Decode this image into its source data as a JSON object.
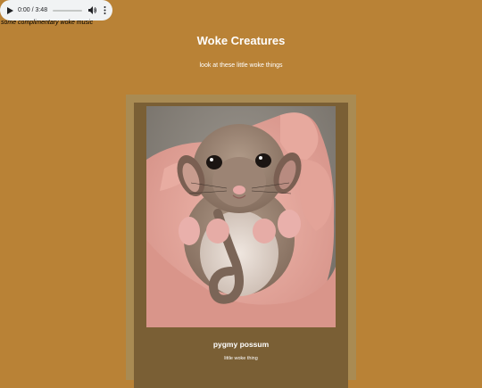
{
  "audio": {
    "time": "0:00 / 3:48",
    "progress": 0,
    "play_icon": "play-icon",
    "volume_icon": "volume-icon",
    "menu_icon": "more-vert-icon"
  },
  "audio_caption": "some complimentary woke music",
  "header": {
    "title": "Woke Creatures",
    "subtitle": "look at these little woke things"
  },
  "card": {
    "title": "pygmy possum",
    "caption": "little woke thing"
  },
  "colors": {
    "page_background": "#b98236",
    "card_frame": "#a98b53",
    "card_background": "#7a5f35"
  }
}
